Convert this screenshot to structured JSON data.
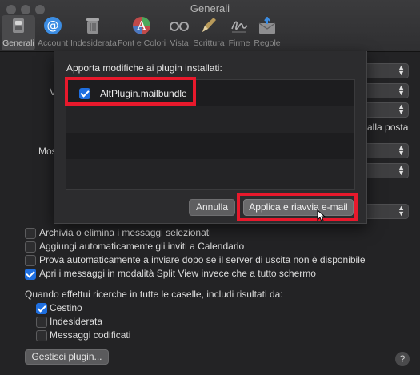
{
  "window": {
    "title": "Generali"
  },
  "toolbar": {
    "items": [
      {
        "label": "Generali",
        "icon": "general-switch-icon"
      },
      {
        "label": "Account",
        "icon": "at-sign-icon"
      },
      {
        "label": "Indesiderata",
        "icon": "junk-trash-icon"
      },
      {
        "label": "Font e Colori",
        "icon": "fonts-colors-icon"
      },
      {
        "label": "Vista",
        "icon": "glasses-icon"
      },
      {
        "label": "Scrittura",
        "icon": "pencil-compose-icon"
      },
      {
        "label": "Firme",
        "icon": "signature-icon"
      },
      {
        "label": "Regole",
        "icon": "rules-envelope-icon"
      }
    ]
  },
  "background": {
    "partial_label_1": "V",
    "partial_label_2": "Mos",
    "partial_text_right": "alla posta",
    "checkboxes": [
      {
        "label": "Archivia o elimina i messaggi selezionati",
        "checked": false
      },
      {
        "label": "Aggiungi automaticamente gli inviti a Calendario",
        "checked": false
      },
      {
        "label": "Prova automaticamente a inviare dopo se il server di uscita non è disponibile",
        "checked": false
      },
      {
        "label": "Apri i messaggi in modalità Split View invece che a tutto schermo",
        "checked": true
      }
    ],
    "search_heading": "Quando effettui ricerche in tutte le caselle, includi risultati da:",
    "search_options": [
      {
        "label": "Cestino",
        "checked": true
      },
      {
        "label": "Indesiderata",
        "checked": false
      },
      {
        "label": "Messaggi codificati",
        "checked": false
      }
    ],
    "manage_plugins_label": "Gestisci plugin...",
    "help_label": "?"
  },
  "sheet": {
    "title": "Apporta modifiche ai plugin installati:",
    "plugins": [
      {
        "label": "AltPlugin.mailbundle",
        "checked": true
      }
    ],
    "cancel_label": "Annulla",
    "apply_label": "Applica e riavvia e-mail"
  },
  "colors": {
    "accent": "#1f6fe0",
    "highlight": "#e8192c"
  }
}
